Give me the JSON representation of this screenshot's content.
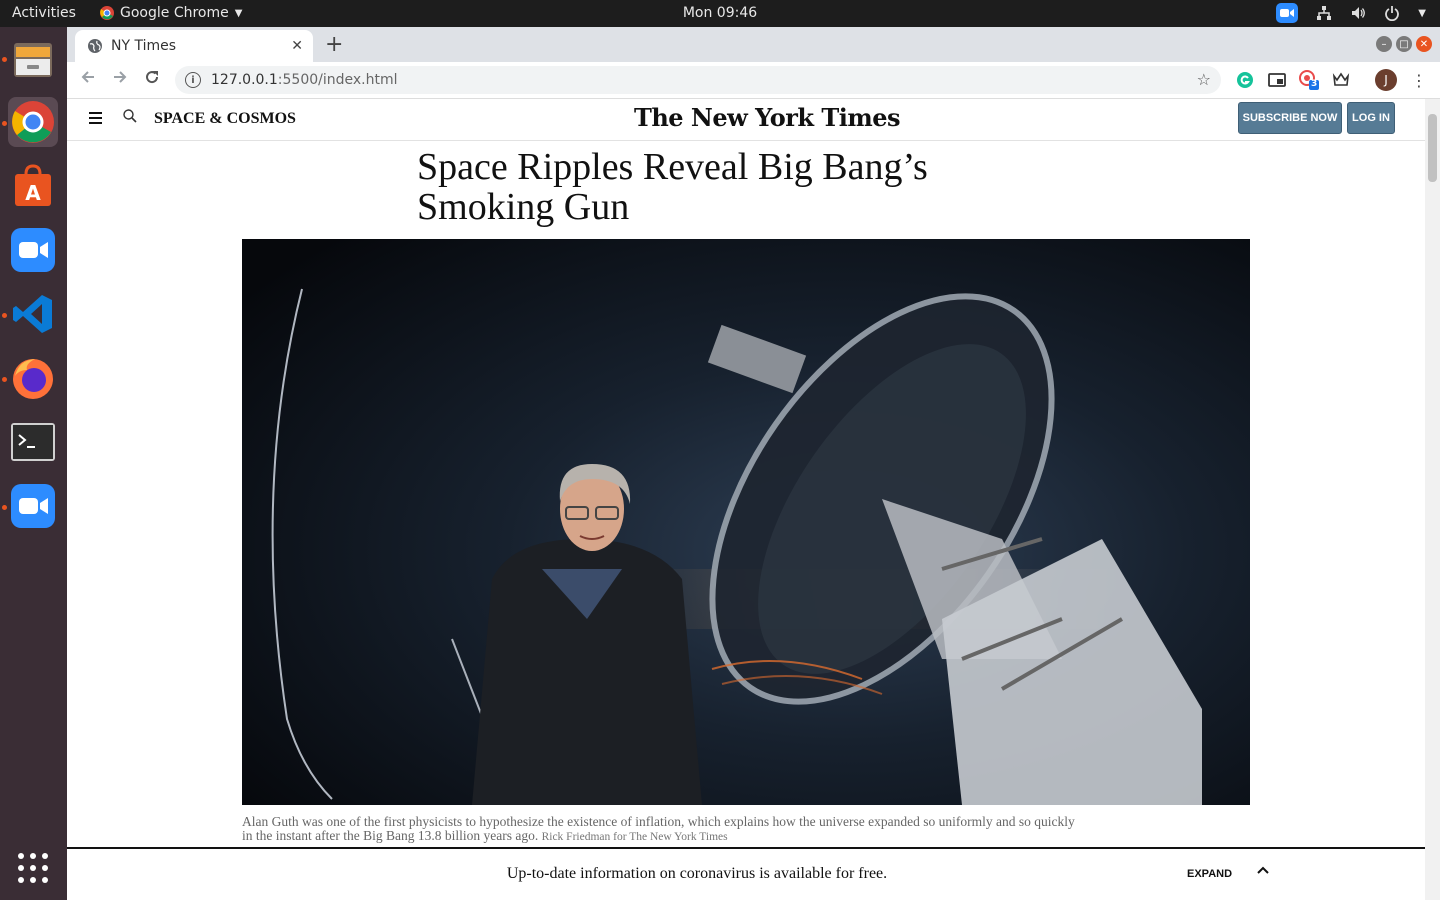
{
  "system": {
    "activities": "Activities",
    "app_name": "Google Chrome",
    "clock": "Mon 09:46"
  },
  "browser": {
    "tab_title": "NY Times",
    "url_host": "127.0.0.1",
    "url_rest": ":5500/index.html",
    "profile_initial": "J",
    "extension_badge": "3"
  },
  "nyt": {
    "section": "SPACE & COSMOS",
    "logo": "The New York Times",
    "subscribe_label": "SUBSCRIBE NOW",
    "login_label": "LOG IN",
    "headline": "Space Ripples Reveal Big Bang’s Smoking Gun",
    "caption": "Alan Guth was one of the first physicists to hypothesize the existence of inflation, which explains how the universe expanded so uniformly and so quickly in the instant after the Big Bang 13.8 billion years ago.",
    "credit": "Rick Friedman for The New York Times",
    "banner_message": "Up-to-date information on coronavirus is available for free.",
    "expand_label": "EXPAND"
  },
  "colors": {
    "ubuntu_orange": "#e95420",
    "nyt_button": "#567b95"
  }
}
